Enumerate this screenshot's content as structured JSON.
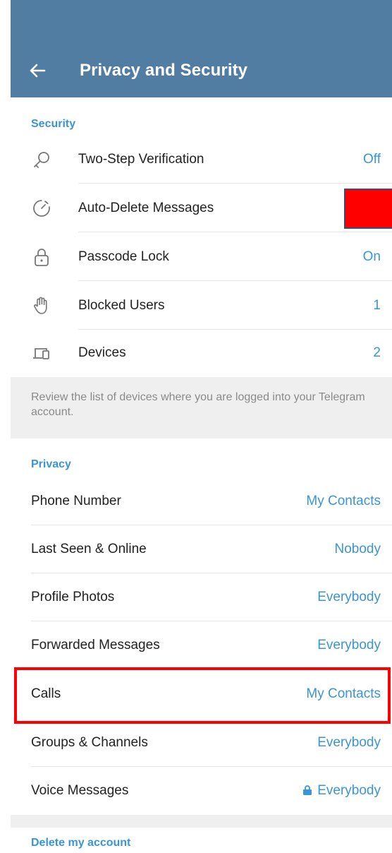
{
  "header": {
    "title": "Privacy and Security",
    "back_icon": "arrow-left-icon"
  },
  "security": {
    "header": "Security",
    "items": [
      {
        "label": "Two-Step Verification",
        "value": "Off",
        "icon": "key-icon"
      },
      {
        "label": "Auto-Delete Messages",
        "value": "",
        "icon": "timer-icon"
      },
      {
        "label": "Passcode Lock",
        "value": "On",
        "icon": "lock-icon"
      },
      {
        "label": "Blocked Users",
        "value": "1",
        "icon": "hand-icon"
      },
      {
        "label": "Devices",
        "value": "2",
        "icon": "devices-icon"
      }
    ],
    "info": "Review the list of devices where you are logged into your Telegram account."
  },
  "privacy": {
    "header": "Privacy",
    "items": [
      {
        "label": "Phone Number",
        "value": "My Contacts"
      },
      {
        "label": "Last Seen & Online",
        "value": "Nobody"
      },
      {
        "label": "Profile Photos",
        "value": "Everybody"
      },
      {
        "label": "Forwarded Messages",
        "value": "Everybody"
      },
      {
        "label": "Calls",
        "value": "My Contacts"
      },
      {
        "label": "Groups & Channels",
        "value": "Everybody"
      },
      {
        "label": "Voice Messages",
        "value": "Everybody"
      }
    ]
  },
  "delete_account": {
    "header": "Delete my account"
  },
  "colors": {
    "header_bg": "#527da3",
    "accent": "#3a95d5",
    "highlight": "#ff0000"
  }
}
